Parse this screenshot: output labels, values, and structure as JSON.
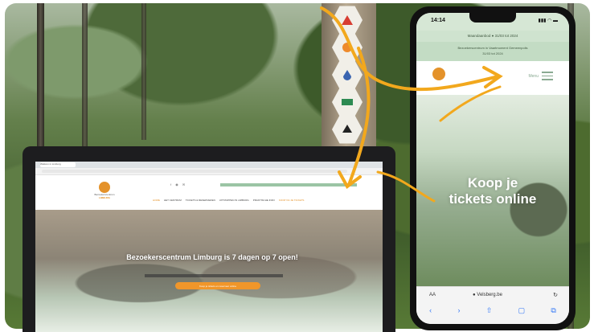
{
  "laptop_site": {
    "tab_title": "Welkom in Limburg",
    "logo_line_1": "Bezoekerscentrum",
    "logo_line_2": "LIMBURG",
    "icons": "f ◉ ✉",
    "nav": [
      "Home",
      "Het centrum",
      "Tickets & reserveren",
      "Uitstappen in Limburg",
      "Praktische info",
      "Koop nu je tickets"
    ],
    "hero_title": "Bezoekerscentrum Limburg is 7 dagen op 7 open!",
    "cta": "Koop je tickets en reserveer online"
  },
  "phone": {
    "time": "14:14",
    "status_icons": "▮▮▮ ◠ ▬",
    "promo_1": "Maandaanbod ● 31/03 tot 2024",
    "promo_2_line_1": "Bezoekerscentrum in Vaartmoment Gemeenpolis",
    "promo_2_line_2": "31/03 tot 2024",
    "menu_label": "Menu",
    "hero_title": "Koop je tickets online",
    "url_aa": "AA",
    "url": "● Velsberg.be",
    "reload": "↻",
    "nav_icons": [
      "‹",
      "›",
      "⇧",
      "▢",
      "⧉"
    ]
  },
  "colors": {
    "accent_orange": "#e4922a",
    "accent_green": "#8aaa92",
    "arrow_yellow": "#f2a81d"
  }
}
